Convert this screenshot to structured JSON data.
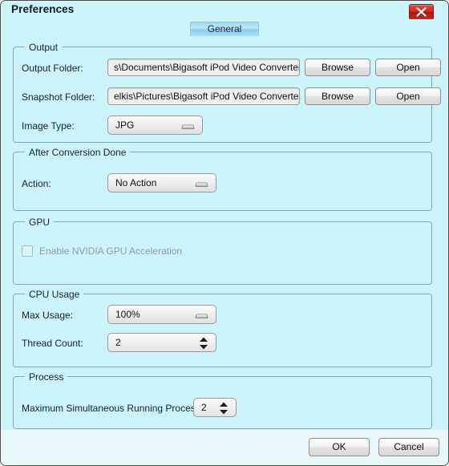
{
  "window": {
    "title": "Preferences",
    "close_icon": "close-icon",
    "accent_color": "#ccf4fb",
    "close_button_color": "#c02a21"
  },
  "tabs": [
    {
      "label": "General",
      "selected": true
    }
  ],
  "groups": {
    "output": {
      "title": "Output",
      "fields": {
        "output_folder": {
          "label": "Output Folder:",
          "value": "s\\Documents\\Bigasoft iPod Video Converter",
          "browse_label": "Browse",
          "open_label": "Open"
        },
        "snapshot_folder": {
          "label": "Snapshot Folder:",
          "value": "elkis\\Pictures\\Bigasoft iPod Video Converter",
          "browse_label": "Browse",
          "open_label": "Open"
        },
        "image_type": {
          "label": "Image Type:",
          "value": "JPG"
        }
      }
    },
    "after_conversion": {
      "title": "After Conversion Done",
      "fields": {
        "action": {
          "label": "Action:",
          "value": "No Action"
        }
      }
    },
    "gpu": {
      "title": "GPU",
      "fields": {
        "enable_nvidia": {
          "label": "Enable NVIDIA GPU Acceleration",
          "checked": false,
          "disabled": true
        }
      }
    },
    "cpu_usage": {
      "title": "CPU Usage",
      "fields": {
        "max_usage": {
          "label": "Max Usage:",
          "value": "100%"
        },
        "thread_count": {
          "label": "Thread Count:",
          "value": "2"
        }
      }
    },
    "process": {
      "title": "Process",
      "fields": {
        "max_processes": {
          "label": "Maximum Simultaneous Running Processes:",
          "value": "2"
        }
      }
    }
  },
  "footer": {
    "ok_label": "OK",
    "cancel_label": "Cancel"
  }
}
